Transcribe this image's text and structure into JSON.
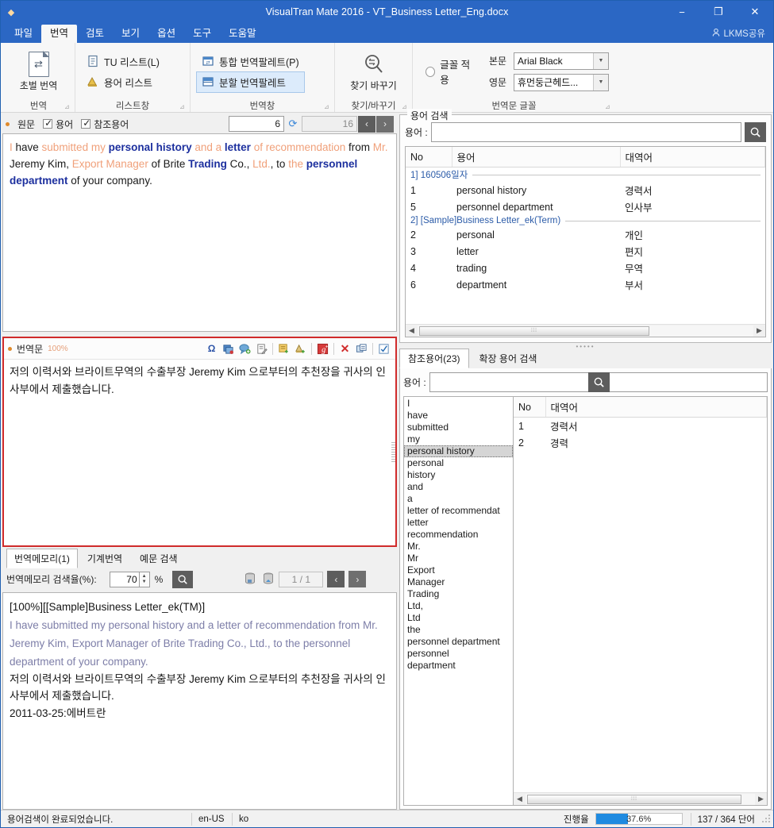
{
  "window": {
    "title": "VisualTran Mate 2016 - VT_Business Letter_Eng.docx",
    "minimize": "−",
    "maximize": "❐",
    "close": "✕"
  },
  "menubar": {
    "items": [
      {
        "label": "파일",
        "active": false
      },
      {
        "label": "번역",
        "active": true
      },
      {
        "label": "검토",
        "active": false
      },
      {
        "label": "보기",
        "active": false
      },
      {
        "label": "옵션",
        "active": false
      },
      {
        "label": "도구",
        "active": false
      },
      {
        "label": "도움말",
        "active": false
      }
    ],
    "account_label": "LKMS공유"
  },
  "ribbon": {
    "groups": [
      {
        "name": "번역",
        "big_button": {
          "label": "초벌 번역",
          "icon": "document-translate-icon"
        }
      },
      {
        "name": "리스트창",
        "buttons": [
          {
            "label": "TU 리스트(L)",
            "icon": "tu-list-icon",
            "selected": false
          },
          {
            "label": "용어 리스트",
            "icon": "term-list-icon",
            "selected": false
          }
        ]
      },
      {
        "name": "번역창",
        "buttons": [
          {
            "label": "통합 번역팔레트(P)",
            "icon": "merged-palette-icon",
            "selected": false
          },
          {
            "label": "분할 번역팔레트",
            "icon": "split-palette-icon",
            "selected": true
          }
        ]
      },
      {
        "name": "찾기/바꾸기",
        "big_button": {
          "label": "찾기 바꾸기",
          "icon": "find-replace-icon"
        }
      },
      {
        "name": "번역문 글꼴",
        "apply_font_label": "글꼴 적용",
        "fonts": [
          {
            "label": "본문",
            "value": "Arial Black"
          },
          {
            "label": "영문",
            "value": "휴먼둥근헤드..."
          }
        ]
      }
    ],
    "dialog_launcher": "⊿"
  },
  "source_panel": {
    "label": "원문",
    "checkboxes": [
      {
        "label": "용어",
        "checked": true
      },
      {
        "label": "참조용어",
        "checked": true
      }
    ],
    "current_segment": "6",
    "total_segments": "16",
    "prev_label": "‹",
    "next_label": "›",
    "refresh_icon": "refresh-icon",
    "segments": [
      {
        "text": "I ",
        "style": "orange"
      },
      {
        "text": "have ",
        "style": "black"
      },
      {
        "text": "submitted my ",
        "style": "orange"
      },
      {
        "text": "personal history",
        "style": "navy"
      },
      {
        "text": " ",
        "style": "black"
      },
      {
        "text": "and a ",
        "style": "orange"
      },
      {
        "text": "letter",
        "style": "navy"
      },
      {
        "text": " ",
        "style": "black"
      },
      {
        "text": "of recommendation",
        "style": "orange"
      },
      {
        "text": " from ",
        "style": "black"
      },
      {
        "text": "Mr.",
        "style": "orange"
      },
      {
        "text": " Jeremy Kim, ",
        "style": "black"
      },
      {
        "text": "Export Manager",
        "style": "orange"
      },
      {
        "text": " of Brite ",
        "style": "black"
      },
      {
        "text": "Trading",
        "style": "navy"
      },
      {
        "text": " Co., ",
        "style": "black"
      },
      {
        "text": "Ltd.",
        "style": "orange"
      },
      {
        "text": ", to ",
        "style": "black"
      },
      {
        "text": "the",
        "style": "orange"
      },
      {
        "text": " ",
        "style": "black"
      },
      {
        "text": "personnel department",
        "style": "navy"
      },
      {
        "text": " of your company.",
        "style": "black"
      }
    ]
  },
  "translation_panel": {
    "label": "번역문",
    "percent": "100%",
    "text": "저의 이력서와 브라이트무역의 수출부장 Jeremy Kim 으로부터의 추천장을 귀사의 인사부에서 제출했습니다.",
    "toolbar_icons": [
      {
        "name": "special-character-icon",
        "glyph": "Ω",
        "color": "#2e55a8"
      },
      {
        "name": "copy-source-icon",
        "glyph": "▤",
        "color": "#3b6fb5"
      },
      {
        "name": "add-comment-icon",
        "glyph": "▣",
        "color": "#4a8a3f"
      },
      {
        "name": "edit-note-icon",
        "glyph": "▤",
        "color": "#6b6b6b"
      },
      {
        "name": "add-term-icon",
        "glyph": "▤",
        "color": "#d9a334"
      },
      {
        "name": "add-tu-icon",
        "glyph": "▥",
        "color": "#8a7a55"
      },
      {
        "name": "google-translate-icon",
        "glyph": "S",
        "color": "#d02b2b"
      },
      {
        "name": "delete-icon",
        "glyph": "✕",
        "color": "#d02b2b"
      },
      {
        "name": "swap-icon",
        "glyph": "⇄",
        "color": "#4a6f9c"
      },
      {
        "name": "confirm-icon",
        "glyph": "☑",
        "color": "#2b6fb5"
      }
    ]
  },
  "bottom_tabs": {
    "tabs": [
      {
        "label": "번역메모리(1)",
        "active": true
      },
      {
        "label": "기계번역",
        "active": false
      },
      {
        "label": "예문 검색",
        "active": false
      }
    ],
    "tm_rate_label": "번역메모리 검색율(%):",
    "tm_rate_value": "70",
    "percent_sign": "%",
    "search_icon": "search-icon",
    "page_indicator": "1 / 1",
    "prev_label": "‹",
    "next_label": "›",
    "db_icons": [
      {
        "name": "tm-list-icon"
      },
      {
        "name": "tm-home-icon"
      }
    ],
    "result": {
      "header": "[100%][[Sample]Business Letter_ek(TM)]",
      "source": "I have submitted my personal history and a letter of recommendation from Mr. Jeremy Kim, Export Manager of Brite Trading Co., Ltd., to the personnel department of your company.",
      "target": "저의 이력서와 브라이트무역의 수출부장 Jeremy Kim 으로부터의 추천장을 귀사의 인사부에서 제출했습니다.",
      "meta": "2011-03-25:에버트란"
    }
  },
  "term_search": {
    "group_title": "용어 검색",
    "field_label": "용어 :",
    "field_value": "",
    "search_icon": "search-icon",
    "columns": [
      "No",
      "용어",
      "대역어"
    ],
    "groups": [
      {
        "title": "1] 160506일자",
        "rows": [
          {
            "no": "1",
            "term": "personal history",
            "translation": "경력서"
          },
          {
            "no": "5",
            "term": "personnel department",
            "translation": "인사부"
          }
        ]
      },
      {
        "title": "2] [Sample]Business Letter_ek(Term)",
        "rows": [
          {
            "no": "2",
            "term": "personal",
            "translation": "개인"
          },
          {
            "no": "3",
            "term": "letter",
            "translation": "편지"
          },
          {
            "no": "4",
            "term": "trading",
            "translation": "무역"
          },
          {
            "no": "6",
            "term": "department",
            "translation": "부서"
          }
        ]
      }
    ]
  },
  "ref_terms": {
    "tabs": [
      {
        "label": "참조용어(23)",
        "active": true
      },
      {
        "label": "확장 용어 검색",
        "active": false
      }
    ],
    "field_label": "용어 :",
    "field_value": "",
    "search_icon": "search-icon",
    "words": [
      {
        "text": "I",
        "selected": false
      },
      {
        "text": "have",
        "selected": false
      },
      {
        "text": "submitted",
        "selected": false
      },
      {
        "text": "my",
        "selected": false
      },
      {
        "text": "personal history",
        "selected": true
      },
      {
        "text": "personal",
        "selected": false
      },
      {
        "text": "history",
        "selected": false
      },
      {
        "text": "and",
        "selected": false
      },
      {
        "text": "a",
        "selected": false
      },
      {
        "text": "letter of recommendat",
        "selected": false
      },
      {
        "text": "letter",
        "selected": false
      },
      {
        "text": "recommendation",
        "selected": false
      },
      {
        "text": "Mr.",
        "selected": false
      },
      {
        "text": "Mr",
        "selected": false
      },
      {
        "text": "Export",
        "selected": false
      },
      {
        "text": "Manager",
        "selected": false
      },
      {
        "text": "Trading",
        "selected": false
      },
      {
        "text": "Ltd,",
        "selected": false
      },
      {
        "text": "Ltd",
        "selected": false
      },
      {
        "text": "the",
        "selected": false
      },
      {
        "text": "personnel department",
        "selected": false
      },
      {
        "text": "personnel",
        "selected": false
      },
      {
        "text": "department",
        "selected": false
      }
    ],
    "columns": [
      "No",
      "대역어"
    ],
    "rows": [
      {
        "no": "1",
        "translation": "경력서"
      },
      {
        "no": "2",
        "translation": "경력"
      }
    ]
  },
  "statusbar": {
    "message": "용어검색이 완료되었습니다.",
    "source_lang": "en-US",
    "target_lang": "ko",
    "progress_label": "진행율",
    "progress_value": "37.6%",
    "progress_percent": 37.6,
    "word_count": "137 / 364 단어"
  },
  "colors": {
    "title_blue": "#2b67c4",
    "accent_red": "#d02b2b",
    "term_navy": "#1c2f9e",
    "term_orange": "#f0a07a",
    "progress_blue": "#1e8ae0"
  }
}
